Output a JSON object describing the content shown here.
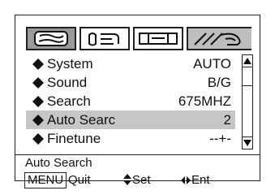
{
  "tabs": [
    {
      "icon": "picture-tab-icon",
      "selected": false
    },
    {
      "icon": "sound-tab-icon",
      "selected": false
    },
    {
      "icon": "feature-tab-icon",
      "selected": false
    },
    {
      "icon": "channel-tab-icon",
      "selected": true
    }
  ],
  "menu": {
    "items": [
      {
        "label": "System",
        "value": "AUTO"
      },
      {
        "label": "Sound",
        "value": "B/G"
      },
      {
        "label": "Search",
        "value": "675MHZ"
      },
      {
        "label": "Auto Searc",
        "value": "2"
      },
      {
        "label": "Finetune",
        "value": "--+-"
      }
    ],
    "selected_index": 3
  },
  "footer": {
    "title": "Auto Search",
    "menu_key": "MENU",
    "quit_label": "Quit",
    "set_label": "Set",
    "ent_label": "Ent"
  },
  "colors": {
    "selection": "#c6c6c6",
    "border": "#222222"
  }
}
